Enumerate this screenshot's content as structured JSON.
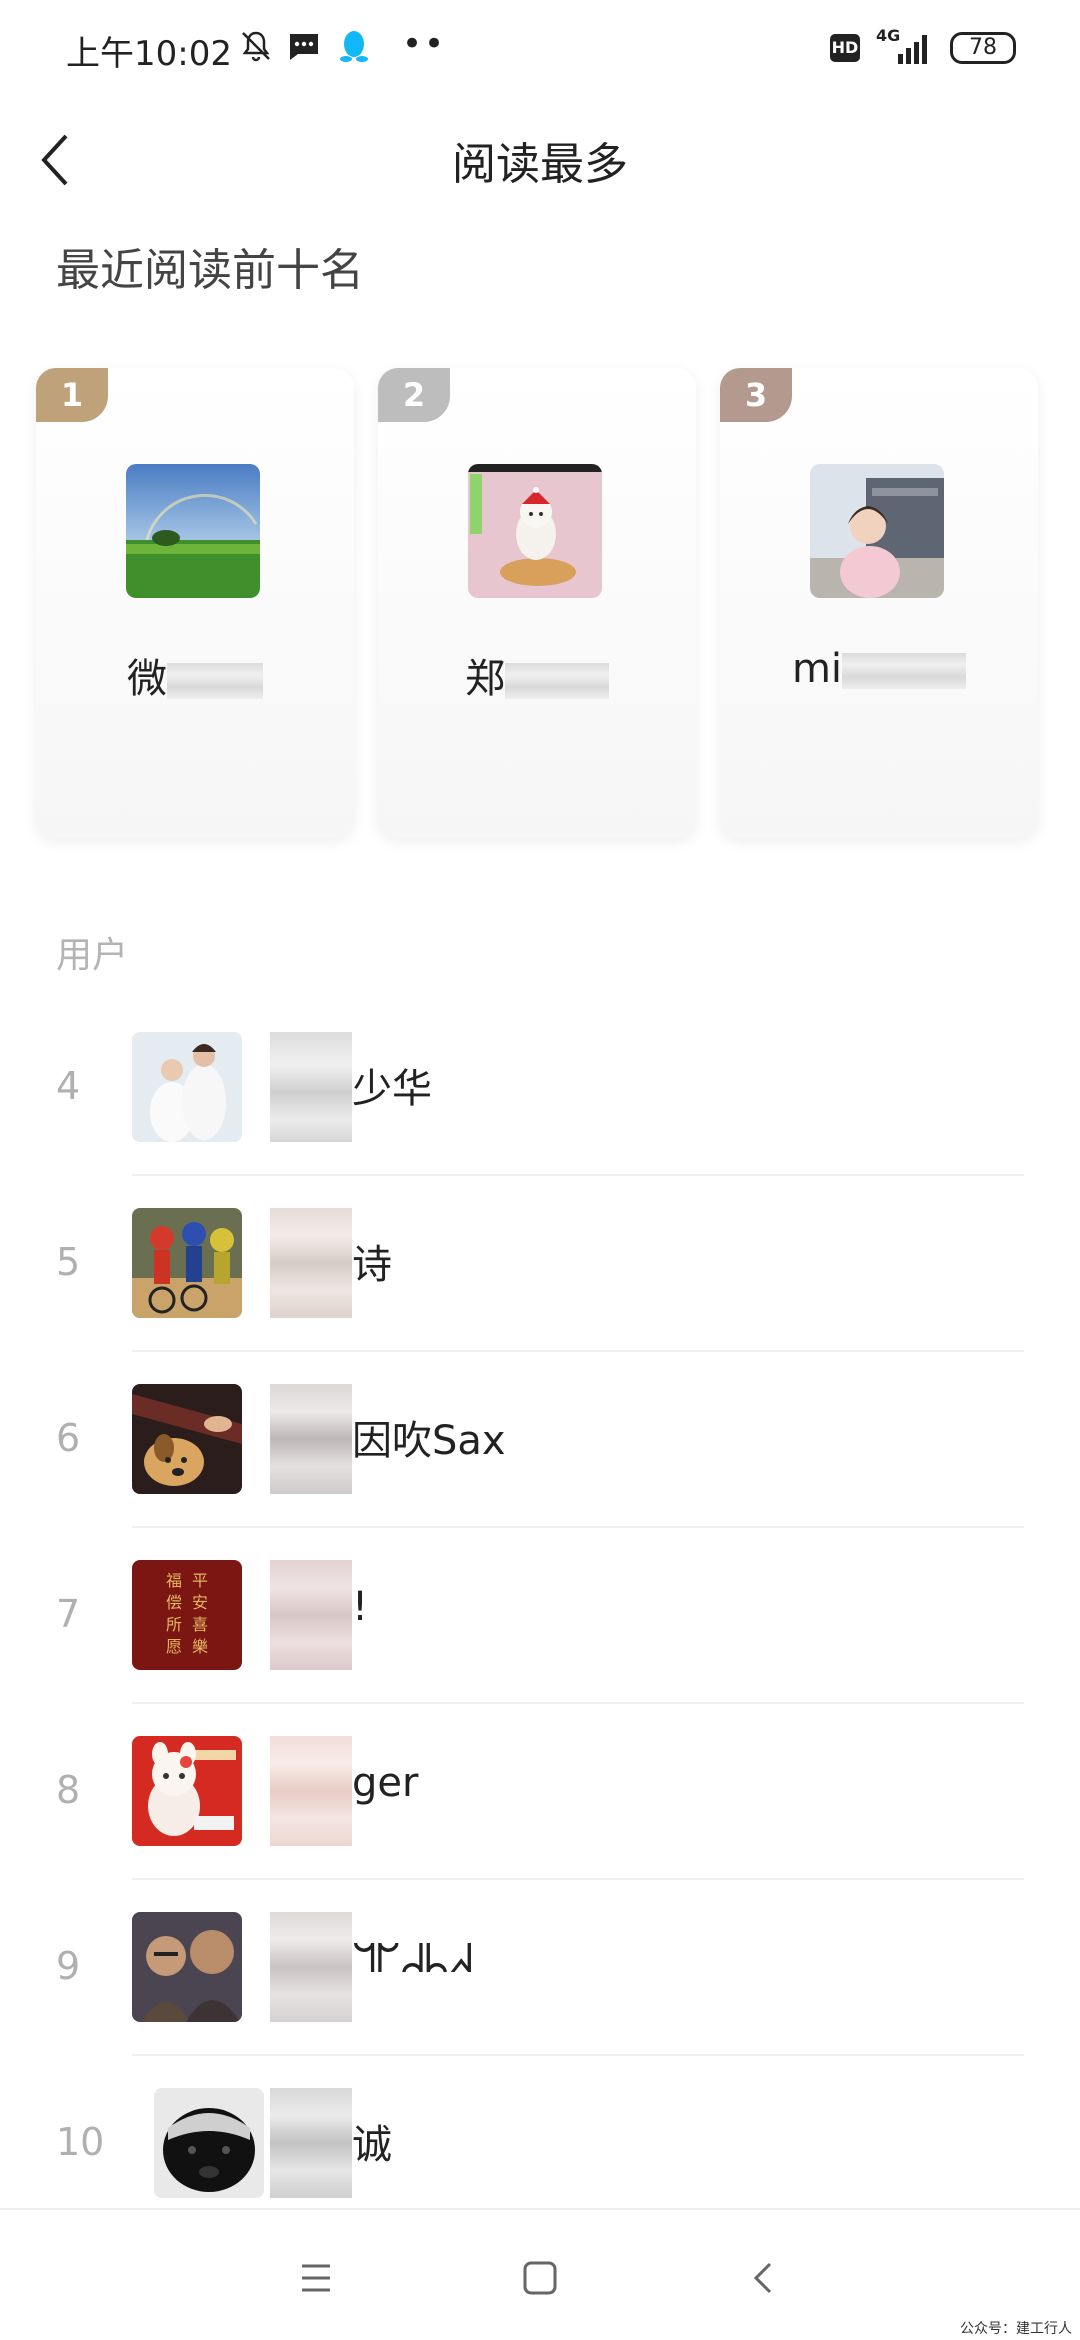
{
  "status_bar": {
    "time": "上午10:02",
    "network": "4G",
    "hd": "HD",
    "battery": "78"
  },
  "header": {
    "title": "阅读最多"
  },
  "top_section": {
    "title": "最近阅读前十名",
    "cards": [
      {
        "rank": "1",
        "name": "微",
        "badge_color": "#bfa27a"
      },
      {
        "rank": "2",
        "name": "郑",
        "badge_color": "#bdbdbd"
      },
      {
        "rank": "3",
        "name": "mi",
        "badge_color": "#b49a8e"
      }
    ]
  },
  "list": {
    "heading": "用户",
    "rows": [
      {
        "rank": "4",
        "name": "少华"
      },
      {
        "rank": "5",
        "name": "诗"
      },
      {
        "rank": "6",
        "name": "因吹Sax"
      },
      {
        "rank": "7",
        "name": "!"
      },
      {
        "rank": "8",
        "name": "ger"
      },
      {
        "rank": "9",
        "name": "ᖻᖸᖹᖺᖽ"
      },
      {
        "rank": "10",
        "name": "诚"
      }
    ]
  },
  "watermark": "公众号：建工行人"
}
